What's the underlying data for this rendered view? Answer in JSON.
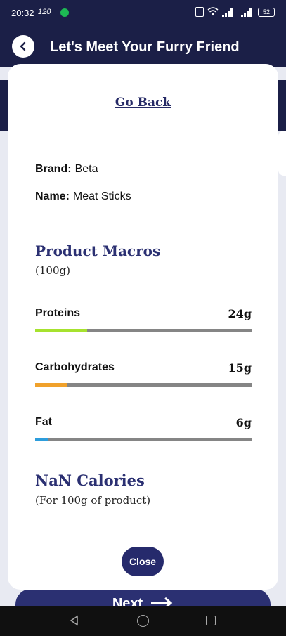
{
  "status_bar": {
    "time": "20:32",
    "rate": "120",
    "battery": "52"
  },
  "header": {
    "title": "Let's Meet Your Furry Friend"
  },
  "modal": {
    "go_back_label": "Go Back",
    "brand_label": "Brand:",
    "brand_value": "Beta",
    "name_label": "Name:",
    "name_value": "Meat Sticks",
    "macros_title": "Product Macros",
    "macros_subtitle": "(100g)",
    "macros": [
      {
        "name": "Proteins",
        "value": "24g",
        "fraction": 0.24,
        "color": "#a6e22e"
      },
      {
        "name": "Carbohydrates",
        "value": "15g",
        "fraction": 0.15,
        "color": "#f0a12b"
      },
      {
        "name": "Fat",
        "value": "6g",
        "fraction": 0.06,
        "color": "#2d9ddc"
      }
    ],
    "calories_title": "NaN Calories",
    "calories_subtitle": "(For 100g of product)",
    "close_label": "Close"
  },
  "footer": {
    "next_label": "Next"
  },
  "colors": {
    "primary": "#1b1f47",
    "accent": "#2b3072",
    "track": "#858585"
  }
}
